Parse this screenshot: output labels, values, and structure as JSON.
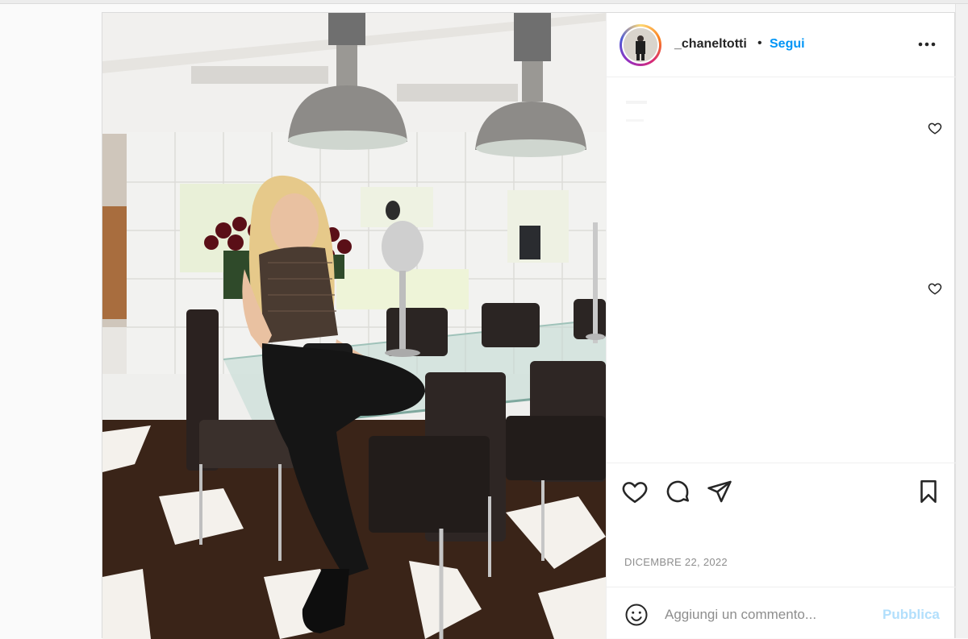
{
  "post": {
    "username": "_chaneltotti",
    "separator": "•",
    "follow_label": "Segui",
    "more_icon": "more-horizontal-icon",
    "date": "DICEMBRE 22, 2022"
  },
  "actions": {
    "like_icon": "heart-icon",
    "comment_icon": "comment-icon",
    "share_icon": "paper-plane-icon",
    "save_icon": "bookmark-icon"
  },
  "composer": {
    "emoji_icon": "smiley-icon",
    "placeholder": "Aggiungi un commento...",
    "publish_label": "Pubblica"
  },
  "colors": {
    "accent": "#0095f6",
    "publish_disabled": "#b2dffc",
    "text": "#262626",
    "muted": "#8e8e8e"
  }
}
